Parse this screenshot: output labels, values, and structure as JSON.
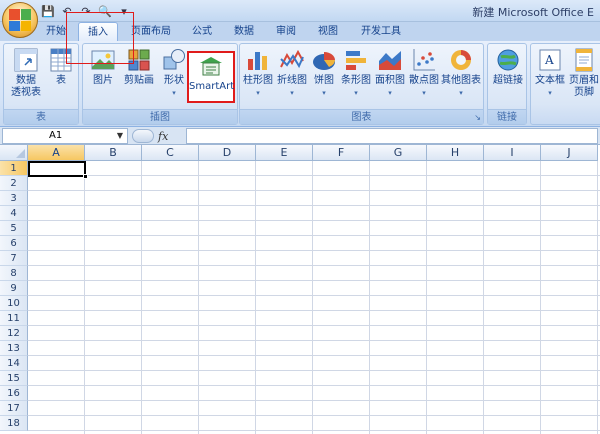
{
  "window": {
    "title": "新建 Microsoft Office E",
    "office_button_icon": "office-logo-icon",
    "quick_access": [
      {
        "icon": "save-icon",
        "glyph": "💾"
      },
      {
        "icon": "undo-icon",
        "glyph": "↶"
      },
      {
        "icon": "redo-icon",
        "glyph": "↷"
      },
      {
        "icon": "print-preview-icon",
        "glyph": "🔍"
      },
      {
        "icon": "customize-dropdown-icon",
        "glyph": "▾"
      }
    ]
  },
  "tabs": [
    {
      "label": "开始",
      "active": false
    },
    {
      "label": "插入",
      "active": true
    },
    {
      "label": "页面布局",
      "active": false
    },
    {
      "label": "公式",
      "active": false
    },
    {
      "label": "数据",
      "active": false
    },
    {
      "label": "审阅",
      "active": false
    },
    {
      "label": "视图",
      "active": false
    },
    {
      "label": "开发工具",
      "active": false
    }
  ],
  "ribbon": {
    "groups": {
      "table": {
        "label": "表",
        "buttons": [
          {
            "label": "数据",
            "label2": "透视表",
            "icon": "pivot-table-icon"
          },
          {
            "label": "表",
            "icon": "table-icon"
          }
        ]
      },
      "illustrations": {
        "label": "插图",
        "buttons": [
          {
            "label": "图片",
            "icon": "picture-icon"
          },
          {
            "label": "剪贴画",
            "icon": "clip-art-icon"
          },
          {
            "label": "形状",
            "icon": "shapes-icon"
          },
          {
            "label": "SmartArt",
            "icon": "smartart-icon"
          }
        ]
      },
      "charts": {
        "label": "图表",
        "buttons": [
          {
            "label": "柱形图",
            "icon": "column-chart-icon"
          },
          {
            "label": "折线图",
            "icon": "line-chart-icon"
          },
          {
            "label": "饼图",
            "icon": "pie-chart-icon"
          },
          {
            "label": "条形图",
            "icon": "bar-chart-icon"
          },
          {
            "label": "面积图",
            "icon": "area-chart-icon"
          },
          {
            "label": "散点图",
            "icon": "scatter-chart-icon"
          },
          {
            "label": "其他图表",
            "icon": "other-charts-icon"
          }
        ]
      },
      "links": {
        "label": "链接",
        "buttons": [
          {
            "label": "超链接",
            "icon": "hyperlink-icon"
          }
        ]
      },
      "text": {
        "label": "",
        "buttons": [
          {
            "label": "文本框",
            "icon": "text-box-icon"
          },
          {
            "label": "页眉和",
            "label2": "页脚",
            "icon": "header-footer-icon"
          }
        ]
      }
    }
  },
  "formula_bar": {
    "name_box": "A1",
    "fx": "fx",
    "formula": ""
  },
  "grid": {
    "columns": [
      "A",
      "B",
      "C",
      "D",
      "E",
      "F",
      "G",
      "H",
      "I",
      "J"
    ],
    "rows": [
      "1",
      "2",
      "3",
      "4",
      "5",
      "6",
      "7",
      "8",
      "9",
      "10",
      "11",
      "12",
      "13",
      "14",
      "15",
      "16",
      "17",
      "18"
    ],
    "selected_cell": "A1",
    "accent_selected": "#f6c762",
    "gridline_color": "#d0d7e5"
  }
}
